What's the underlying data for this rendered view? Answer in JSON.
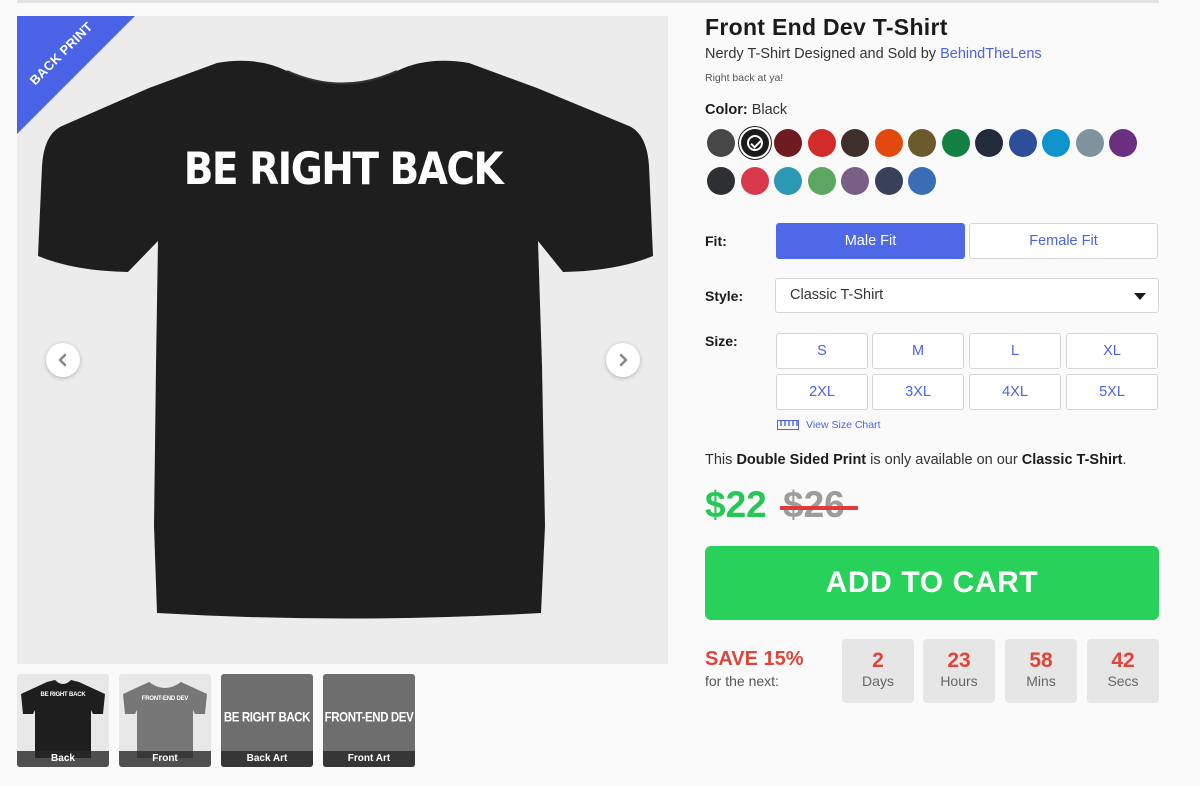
{
  "product": {
    "title": "Front End Dev T-Shirt",
    "byline_prefix": "Nerdy T-Shirt Designed and Sold by",
    "author": "BehindTheLens",
    "tagline": "Right back at ya!"
  },
  "gallery": {
    "ribbon": "BACK PRINT",
    "print_text": "BE RIGHT BACK",
    "thumbnails": [
      {
        "label": "Back",
        "print": "BE RIGHT BACK"
      },
      {
        "label": "Front",
        "print": "FRONT-END DEV"
      },
      {
        "label": "Back Art",
        "print": "BE RIGHT BACK"
      },
      {
        "label": "Front Art",
        "print": "FRONT-END DEV"
      }
    ]
  },
  "color": {
    "label": "Color:",
    "value": "Black",
    "swatches": [
      {
        "name": "Charcoal",
        "hex": "#474747"
      },
      {
        "name": "Black",
        "hex": "#1b1b1b",
        "selected": true
      },
      {
        "name": "Maroon",
        "hex": "#6e1c22"
      },
      {
        "name": "Red",
        "hex": "#d12b2b"
      },
      {
        "name": "Brown",
        "hex": "#3f2f2a"
      },
      {
        "name": "Orange",
        "hex": "#e2490f"
      },
      {
        "name": "Olive",
        "hex": "#6a5a2c"
      },
      {
        "name": "Kelly Green",
        "hex": "#128040"
      },
      {
        "name": "Navy",
        "hex": "#222b3a"
      },
      {
        "name": "Royal Blue",
        "hex": "#2d4f99"
      },
      {
        "name": "Sapphire",
        "hex": "#0e93cc"
      },
      {
        "name": "Slate",
        "hex": "#7f939d"
      },
      {
        "name": "Purple",
        "hex": "#6a2f7e"
      },
      {
        "name": "Heather Black",
        "hex": "#2d2f33"
      },
      {
        "name": "Heather Red",
        "hex": "#d83a4c"
      },
      {
        "name": "Heather Turquoise",
        "hex": "#2c99b2"
      },
      {
        "name": "Heather Green",
        "hex": "#5ba861"
      },
      {
        "name": "Heather Purple",
        "hex": "#7b5e86"
      },
      {
        "name": "Heather Navy",
        "hex": "#39415a"
      },
      {
        "name": "Heather Blue",
        "hex": "#3a6eb4"
      }
    ]
  },
  "fit": {
    "label": "Fit:",
    "options": [
      "Male Fit",
      "Female Fit"
    ],
    "selected": "Male Fit"
  },
  "style": {
    "label": "Style:",
    "value": "Classic T-Shirt"
  },
  "size": {
    "label": "Size:",
    "options": [
      "S",
      "M",
      "L",
      "XL",
      "2XL",
      "3XL",
      "4XL",
      "5XL"
    ],
    "chart_link": "View Size Chart"
  },
  "notice": {
    "prefix": "This",
    "bold1": "Double Sided Print",
    "middle": "is only available on our",
    "bold2": "Classic T-Shirt",
    "suffix": "."
  },
  "price": {
    "current": "$22",
    "original": "$26"
  },
  "cart": {
    "label": "ADD TO CART"
  },
  "promo": {
    "save": "SAVE 15%",
    "sub": "for the next:",
    "countdown": [
      {
        "value": "2",
        "unit": "Days"
      },
      {
        "value": "23",
        "unit": "Hours"
      },
      {
        "value": "58",
        "unit": "Mins"
      },
      {
        "value": "42",
        "unit": "Secs"
      }
    ]
  },
  "colors": {
    "accent": "#4b63e6",
    "cta": "#27d15a",
    "price": "#25c855",
    "sale": "#e0443a"
  }
}
